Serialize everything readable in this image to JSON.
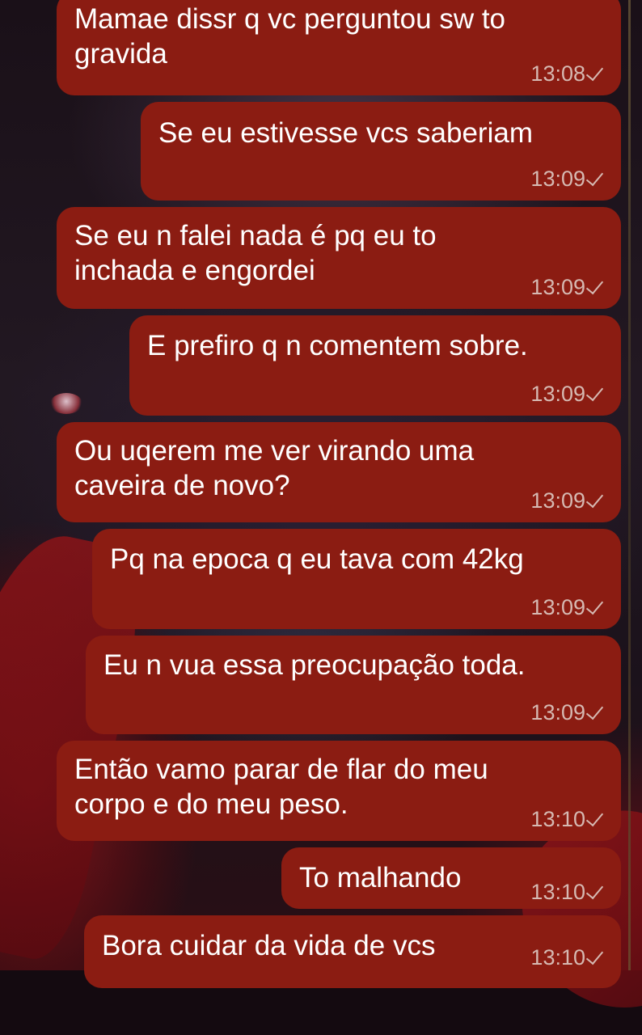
{
  "messages": [
    {
      "text": "Mamae dissr q vc perguntou sw to\ngravida",
      "time": "13:08"
    },
    {
      "text": "Se eu estivesse vcs saberiam",
      "time": "13:09"
    },
    {
      "text": "Se eu n falei nada é pq eu to\ninchada e engordei",
      "time": "13:09"
    },
    {
      "text": "E prefiro q n comentem sobre.",
      "time": "13:09"
    },
    {
      "text": "Ou uqerem me ver virando uma\ncaveira de novo?",
      "time": "13:09"
    },
    {
      "text": "Pq na epoca q eu tava com 42kg",
      "time": "13:09"
    },
    {
      "text": "Eu n vua essa preocupação toda.",
      "time": "13:09"
    },
    {
      "text": "Então vamo parar de flar do meu\ncorpo e do meu peso.",
      "time": "13:10"
    },
    {
      "text": "To malhando",
      "time": "13:10"
    },
    {
      "text": "Bora cuidar da vida de vcs",
      "time": "13:10"
    }
  ],
  "status_icon": "single-check-icon",
  "colors": {
    "bubble": "#8b1c12",
    "text": "#ffffff",
    "meta": "#d6b9b2"
  }
}
